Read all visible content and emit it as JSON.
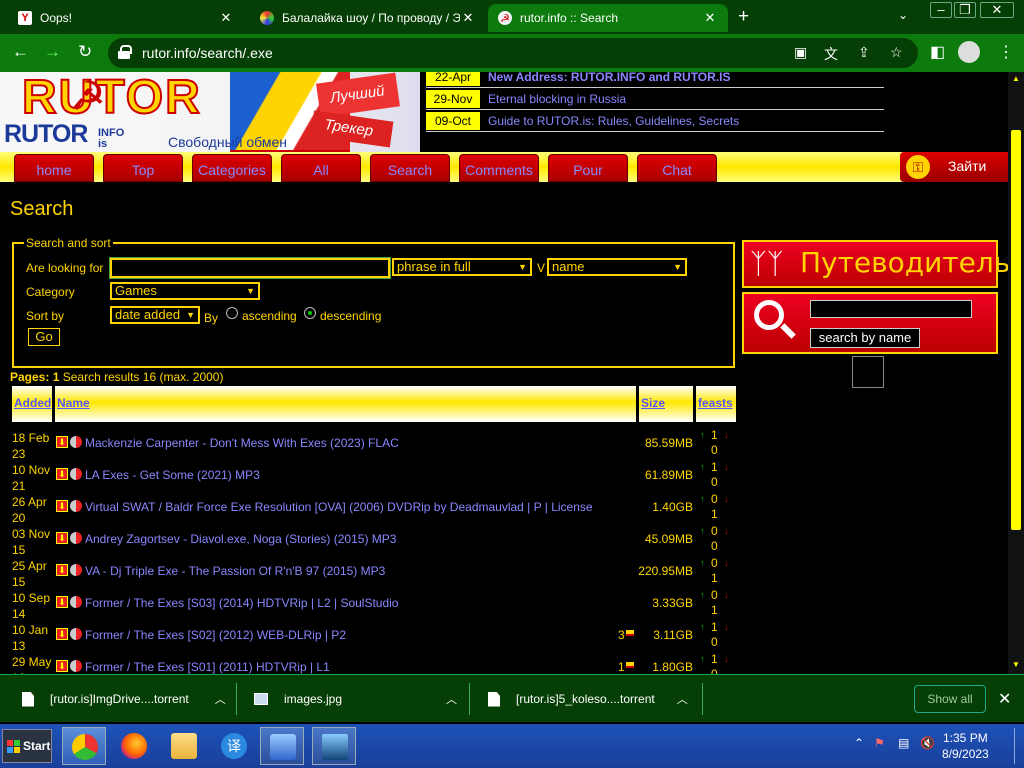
{
  "browser": {
    "tabs": [
      {
        "title": "Oops!",
        "icon": "yandex-icon"
      },
      {
        "title": "Балалайка шоу / По проводу / Эт",
        "icon": "rainbow-icon"
      },
      {
        "title": "rutor.info :: Search",
        "icon": "rutor-icon",
        "active": true
      }
    ],
    "url": "rutor.info/search/.exe"
  },
  "logo": {
    "brand": "RUTOR",
    "brand_small": "RUTOR",
    "domain": "INFO\nis",
    "tagline_best": "Лучший",
    "tagline_tracker": "Трекер",
    "tagline_free": "Свободный обмен"
  },
  "news": [
    {
      "date": "22-Apr",
      "text": "New Address: RUTOR.INFO and RUTOR.IS",
      "bold": true
    },
    {
      "date": "29-Nov",
      "text": "Eternal blocking in Russia"
    },
    {
      "date": "09-Oct",
      "text": "Guide to RUTOR.is: Rules, Guidelines, Secrets"
    }
  ],
  "menu": [
    "home",
    "Top",
    "Categories",
    "All",
    "Search",
    "Comments",
    "Pour",
    "Chat"
  ],
  "login_label": "Зайти",
  "page_title": "Search",
  "search_form": {
    "legend": "Search and sort",
    "looking_label": "Are looking for",
    "query_value": "",
    "mode_select": "phrase in full",
    "v_label": "V",
    "field_select": "name",
    "category_label": "Category",
    "category_select": "Games",
    "sort_label": "Sort by",
    "sort_select": "date added",
    "by_label": "By",
    "ascending": "ascending",
    "descending": "descending",
    "go": "Go"
  },
  "sidebar": {
    "guide": "Путеводитель",
    "search_by_name": "search by name"
  },
  "pages": {
    "label": "Pages:",
    "value": "1",
    "summary": "Search results 16 (max. 2000)"
  },
  "columns": {
    "added": "Added",
    "name": "Name",
    "size": "Size",
    "feasts": "feasts"
  },
  "results": [
    {
      "date": "18 Feb 23",
      "name": "Mackenzie Carpenter - Don't Mess With Exes (2023) FLAC",
      "comments": "",
      "size": "85.59MB",
      "up": "1",
      "down": "0"
    },
    {
      "date": "10 Nov 21",
      "name": "LA Exes - Get Some (2021) MP3",
      "comments": "",
      "size": "61.89MB",
      "up": "1",
      "down": "0"
    },
    {
      "date": "26 Apr 20",
      "name": "Virtual SWAT / Baldr Force Exe Resolution [OVA] (2006) DVDRip by Deadmauvlad | P | License",
      "comments": "",
      "size": "1.40GB",
      "up": "0",
      "down": "1"
    },
    {
      "date": "03 Nov 15",
      "name": "Andrey Zagortsev - Diavol.exe, Noga (Stories) (2015) MP3",
      "comments": "",
      "size": "45.09MB",
      "up": "0",
      "down": "0"
    },
    {
      "date": "25 Apr 15",
      "name": "VA - Dj Triple Exe - The Passion Of R'n'B 97 (2015) MP3",
      "comments": "",
      "size": "220.95MB",
      "up": "0",
      "down": "1"
    },
    {
      "date": "10 Sep 14",
      "name": "Former / The Exes [S03] (2014) HDTVRip | L2 | SoulStudio",
      "comments": "",
      "size": "3.33GB",
      "up": "0",
      "down": "1"
    },
    {
      "date": "10 Jan 13",
      "name": "Former / The Exes [S02] (2012) WEB-DLRip | P2",
      "comments": "3",
      "size": "3.11GB",
      "up": "1",
      "down": "0"
    },
    {
      "date": "29 May 12",
      "name": "Former / The Exes [S01] (2011) HDTVRip | L1",
      "comments": "1",
      "size": "1.80GB",
      "up": "1",
      "down": "0"
    }
  ],
  "downloads": [
    {
      "name": "[rutor.is]ImgDrive....torrent",
      "type": "file"
    },
    {
      "name": "images.jpg",
      "type": "image"
    },
    {
      "name": "[rutor.is]5_koleso....torrent",
      "type": "file"
    }
  ],
  "show_all": "Show all",
  "taskbar": {
    "start": "Start",
    "time": "1:35 PM",
    "date": "8/9/2023"
  },
  "colors": {
    "accent": "#ffd400",
    "link": "#8888ff",
    "chrome": "#0c7a0c",
    "menu_red": "#cc0000"
  }
}
